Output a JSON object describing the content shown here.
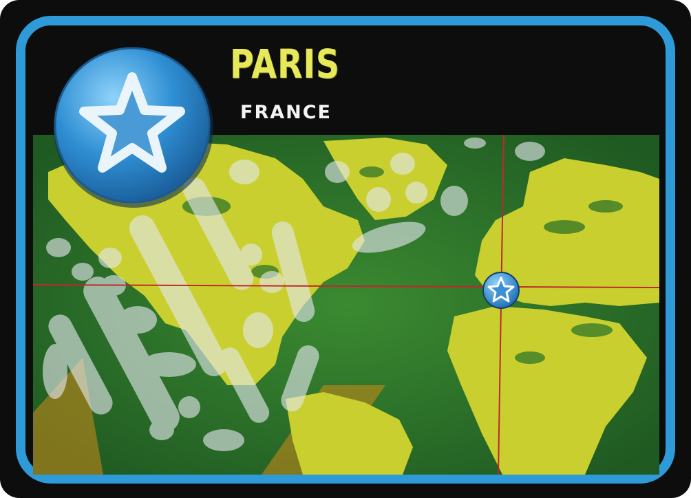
{
  "card": {
    "city": "PARIS",
    "country": "FRANCE"
  },
  "icons": {
    "badge": "blue-star-badge-icon",
    "marker": "blue-star-marker-icon"
  },
  "colors": {
    "frame": "#2f9ad8",
    "background": "#0d0d0d",
    "map_ocean": "#2f7a2c",
    "map_land": "#c9cf2e",
    "city_title": "#e7e85a",
    "gridline": "#c1272d"
  }
}
